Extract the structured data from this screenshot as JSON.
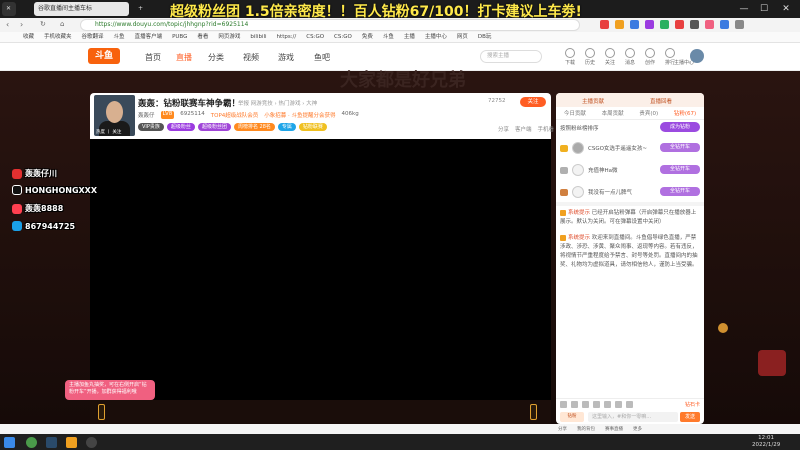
{
  "browser": {
    "tabs": [
      {
        "label": "谷歌直播间主播车标"
      },
      {
        "label": "+"
      }
    ],
    "url": "https://www.douyu.com/topic/jhhgnp?rid=6925114",
    "bookmarks": [
      "收藏",
      "手机收藏夹",
      "谷歌翻译",
      "斗鱼",
      "直播客户端",
      "PUBG",
      "看看",
      "网页游戏",
      "bilibili",
      "https://",
      "CS:GO",
      "CS:GO",
      "免费",
      "斗鱼",
      "主播",
      "主播中心",
      "网页",
      "DB玩"
    ],
    "window_controls": [
      "—",
      "☐",
      "✕"
    ]
  },
  "banner": {
    "text": "超级粉丝团 1.5倍亲密度！！百人钻粉67/100！打卡建议上车劵!"
  },
  "site_nav": {
    "logo": "斗鱼",
    "links": [
      "首页",
      "直播",
      "分类",
      "视频",
      "游戏",
      "鱼吧"
    ],
    "active": "直播",
    "search_placeholder": "搜索主播",
    "icons": [
      {
        "name": "download",
        "label": "下载"
      },
      {
        "name": "history",
        "label": "历史"
      },
      {
        "name": "follow",
        "label": "关注"
      },
      {
        "name": "message",
        "label": "消息"
      },
      {
        "name": "create",
        "label": "创作"
      },
      {
        "name": "rank",
        "label": "排行"
      },
      {
        "name": "anchor",
        "label": "主播中心"
      }
    ]
  },
  "room": {
    "bg_text": "大家都是好兄弟",
    "title": "轰轰：钻粉联赛车神争霸！",
    "category": "举报  网游竞技 › 热门游戏 › 大神",
    "streamer": "轰轰仔",
    "level": "LV8",
    "room_id": "6925114",
    "meta": [
      "TOP4超级战队会员",
      "小象招募 · 斗鱼提醒分会获得"
    ],
    "followers": "72752",
    "heat": "406kg",
    "follow_label": "关注",
    "avatar_tag": "热度 丨 关注",
    "badges": [
      {
        "text": "VIP贵族",
        "color": "#555555"
      },
      {
        "text": "超级粉丝",
        "color": "#9b3be0"
      },
      {
        "text": "超级粉丝团",
        "color": "#a045d8"
      },
      {
        "text": "周榜排名 28名",
        "color": "#ff8a1f"
      },
      {
        "text": "专属",
        "color": "#1fa5e8"
      },
      {
        "text": "钻粉联赛",
        "color": "#f0c020"
      }
    ],
    "actions": [
      "分享",
      "客户端",
      "手机看"
    ]
  },
  "overlay": {
    "socials": [
      {
        "label": "轰轰仔川",
        "icon_color": "#e23030"
      },
      {
        "label": "HONGHONGXXX",
        "icon_color": "#111111"
      },
      {
        "label": "轰轰8888",
        "icon_color": "#ff4050"
      },
      {
        "label": "867944725",
        "icon_color": "#1aa0e8"
      }
    ],
    "pink_banner": "主播加鱼丸抽奖，可在右侧开启“钻粉开车”开播，加群获得福利哦"
  },
  "right_panel": {
    "top_items": [
      "主播贡献",
      "直播回看"
    ],
    "tabs": [
      "今日贡献",
      "本周贡献",
      "贵宾(0)",
      "钻粉(67)"
    ],
    "active_tab": "钻粉(67)",
    "sub": "按照粉丝榜排序",
    "open_btn": "成为钻粉",
    "ranking": [
      {
        "name": "CSGO女选手遥遥女孩~",
        "btn": "全钻开车"
      },
      {
        "name": "充值神Ha微",
        "btn": "全钻开车"
      },
      {
        "name": "我没有一点儿脾气",
        "btn": "全钻开车"
      }
    ],
    "chat": [
      {
        "tag": "系统提示",
        "text": "已经开启钻粉弹幕（开启弹幕只在播放器上展示。默认为关闭。可在弹幕设置中关闭）"
      },
      {
        "tag": "系统提示",
        "text": "欢迎来到直播间。斗鱼倡导绿色直播，严禁涉政、涉恐、涉黄、聚众闹事、返现等内容。若有违反，将视情节严重程度给予禁言、封号等处罚。直播间内的抽奖、礼物均为虚拟道具，请勿相信他人，谨防上当受骗。"
      }
    ],
    "vtab": "钻粉",
    "input_placeholder": "这里输入，#和你一零嘛…",
    "send": "发送",
    "level_label": "钻石卡"
  },
  "bottom_strip": [
    "分享",
    "我的背包",
    "赛事直播",
    "更多"
  ],
  "taskbar": {
    "time": "12:01",
    "date": "2022/1/29"
  }
}
